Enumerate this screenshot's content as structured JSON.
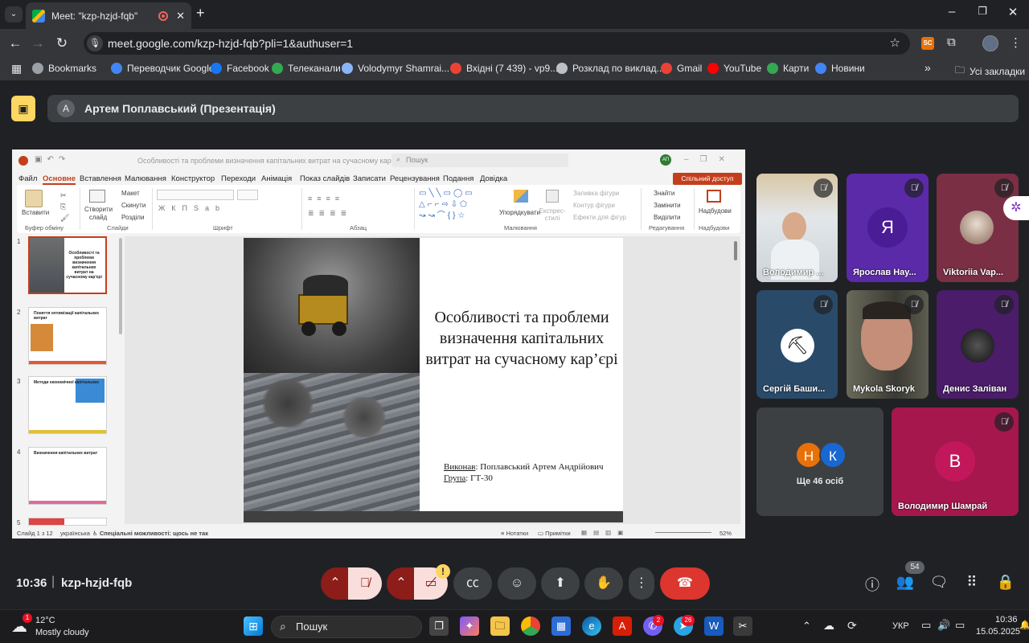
{
  "browser": {
    "tab_title": "Meet: \"kzp-hzjd-fqb\"",
    "url": "meet.google.com/kzp-hzjd-fqb?pli=1&authuser=1",
    "ext_badge": "SC",
    "bookmarks": [
      {
        "label": "Bookmarks",
        "color": "#9aa0a6"
      },
      {
        "label": "Переводчик Google",
        "color": "#4285f4"
      },
      {
        "label": "Facebook",
        "color": "#1877f2"
      },
      {
        "label": "Телеканали",
        "color": "#34a853"
      },
      {
        "label": "Volodymyr Shamrai...",
        "color": "#8ab4f8"
      },
      {
        "label": "Вхідні (7 439) - vp9...",
        "color": "#ea4335"
      },
      {
        "label": "Розклад по виклад...",
        "color": "#bdc1c6"
      },
      {
        "label": "Gmail",
        "color": "#ea4335"
      },
      {
        "label": "YouTube",
        "color": "#ff0000"
      },
      {
        "label": "Карти",
        "color": "#34a853"
      },
      {
        "label": "Новини",
        "color": "#4285f4"
      }
    ],
    "all_bookmarks": "Усі закладки"
  },
  "meet": {
    "presenter_initial": "А",
    "presenter_banner": "Артем Поплавський (Презентація)",
    "meeting_time": "10:36",
    "meeting_code": "kzp-hzjd-fqb",
    "participant_count": "54",
    "participants": [
      {
        "name": "Володимир ...",
        "initial": ""
      },
      {
        "name": "Ярослав Нау...",
        "initial": "Я"
      },
      {
        "name": "Viktoriia Vap...",
        "initial": ""
      },
      {
        "name": "Сергій Баши...",
        "initial": ""
      },
      {
        "name": "Mykola Skoryk",
        "initial": ""
      },
      {
        "name": "Денис Заліван",
        "initial": ""
      }
    ],
    "others": {
      "label": "Ще 46 осіб",
      "initials": [
        "Н",
        "К"
      ]
    },
    "shamrai": {
      "name": "Володимир Шамрай",
      "initial": "B"
    }
  },
  "ppt": {
    "doc_title": "Особливості та проблеми визначення капітальних витрат на сучасному кар'єрі – PowerP...",
    "search": "Пошук",
    "user_initials": "АП",
    "share": "Спільний доступ",
    "menu": [
      "Файл",
      "Основне",
      "Вставлення",
      "Малювання",
      "Конструктор",
      "Переходи",
      "Анімація",
      "Показ слайдів",
      "Записати",
      "Рецензування",
      "Подання",
      "Довідка"
    ],
    "ribbon": {
      "paste": "Вставити",
      "clipboard": "Буфер обміну",
      "new_slide": "Створити слайд",
      "layout": "Макет",
      "reset": "Скинути",
      "sections": "Розділи",
      "slides": "Слайди",
      "font": "Шрифт",
      "paragraph": "Абзац",
      "arrange": "Упорядкувати",
      "quick_styles": "Експрес-стилі",
      "shape_fill": "Заливка фігури",
      "shape_outline": "Контур фігури",
      "shape_effects": "Ефекти для фігур",
      "drawing": "Малювання",
      "find": "Знайти",
      "replace": "Замінити",
      "select": "Виділити",
      "editing": "Редагування",
      "addins": "Надбудови",
      "addins_group": "Надбудови"
    },
    "thumbnails": [
      {
        "num": "1",
        "title": "Особливості та проблеми визначення капітальних витрат на сучасному кар'єрі"
      },
      {
        "num": "2",
        "title": "Поняття оптимізації капітальних витрат"
      },
      {
        "num": "3",
        "title": "Методи економічної капітальних"
      },
      {
        "num": "4",
        "title": "Визначення капітальних витрат"
      },
      {
        "num": "5",
        "title": ""
      }
    ],
    "slide": {
      "title": "Особливості та проблеми визначення капітальних витрат на сучасному кар’єрі",
      "author_label": "Виконав",
      "author": ": Поплавський Артем Андрійович",
      "group_label": "Група",
      "group": ": ГТ-30"
    },
    "status": {
      "slide_of": "Слайд 1 з 12",
      "lang": "українська",
      "accessibility": "Спеціальні можливості: щось не так",
      "notes": "Нотатки",
      "comments": "Примітки",
      "zoom": "52%"
    }
  },
  "taskbar": {
    "weather_temp": "12°C",
    "weather_desc": "Mostly cloudy",
    "search": "Пошук",
    "lang": "УКР",
    "time": "10:36",
    "date": "15.05.2025",
    "badge_weather": "1",
    "badge_viber": "2",
    "badge_telegram": "26"
  }
}
